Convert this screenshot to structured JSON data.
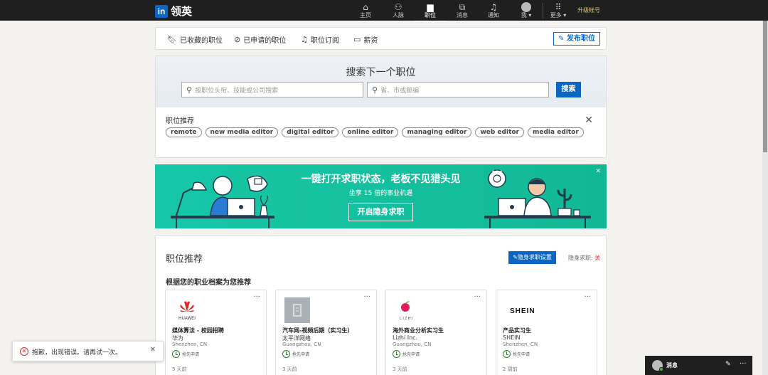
{
  "brand": {
    "logo_text": "in",
    "name": "领英"
  },
  "nav": {
    "items": [
      {
        "label": "主页",
        "icon": "home-icon"
      },
      {
        "label": "人脉",
        "icon": "people-icon"
      },
      {
        "label": "职位",
        "icon": "briefcase-icon"
      },
      {
        "label": "消息",
        "icon": "message-icon"
      },
      {
        "label": "通知",
        "icon": "bell-icon"
      },
      {
        "label": "我 ▾",
        "icon": "avatar"
      },
      {
        "label": "更多 ▾",
        "icon": "grid-icon"
      }
    ],
    "upgrade": "升级帐号"
  },
  "subbar": {
    "saved": "已收藏的职位",
    "applied": "已申请的职位",
    "alerts": "职位订阅",
    "salary": "薪资",
    "post": "发布职位"
  },
  "search": {
    "title": "搜索下一个职位",
    "keyword_placeholder": "按职位头衔、技能或公司搜索",
    "location_placeholder": "省、市或邮编",
    "button": "搜索",
    "rec_label": "职位推荐",
    "tags": [
      "remote",
      "new media editor",
      "digital editor",
      "online editor",
      "managing editor",
      "web editor",
      "media editor"
    ]
  },
  "banner": {
    "title": "一键打开求职状态，老板不见猎头见",
    "subtitle": "坐享 15 倍的事业机遇",
    "button": "开启隐身求职",
    "colors": {
      "bg": "#17c7a8"
    }
  },
  "recommend": {
    "title": "职位推荐",
    "stealth_button": "隐身求职设置",
    "stealth_label": "隐身求职: ",
    "stealth_state": "关",
    "subtitle": "根据您的职业档案为您推荐",
    "jobs": [
      {
        "title": "媒体算法 - 校园招聘",
        "company": "华为",
        "location": "Shenzhen, CN",
        "apply": "抢先申请",
        "time": "5 天前",
        "logo": "HUAWEI"
      },
      {
        "title": "汽车网-视频后期（实习生）",
        "company": "太平洋网络",
        "location": "Guangzhou, CN",
        "apply": "抢先申请",
        "time": "3 天前",
        "logo": ""
      },
      {
        "title": "海外商业分析实习生",
        "company": "Lizhi Inc.",
        "location": "Guangzhou, CN",
        "apply": "抢先申请",
        "time": "3 天前",
        "logo": "LIZHI"
      },
      {
        "title": "产品实习生",
        "company": "SHEIN",
        "location": "Shenzhen, CN",
        "apply": "抢先申请",
        "time": "2 周前",
        "logo": "SHEIN"
      }
    ]
  },
  "toast": {
    "message": "抱歉，出现错误。请再试一次。"
  },
  "messages": {
    "label": "消息"
  }
}
